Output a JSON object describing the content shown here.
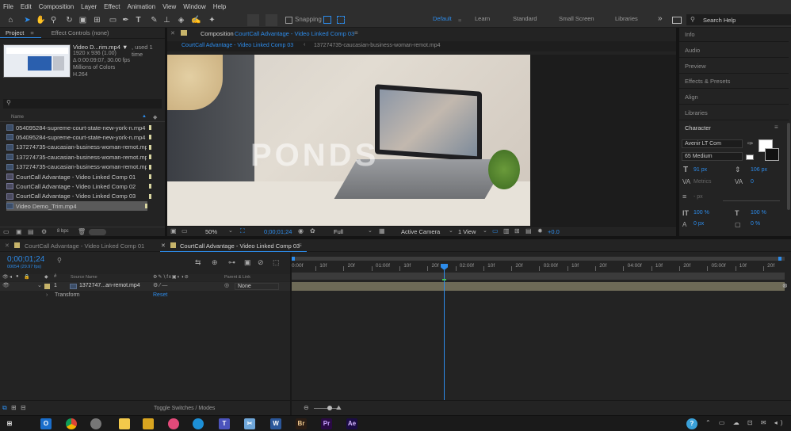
{
  "menu": [
    "File",
    "Edit",
    "Composition",
    "Layer",
    "Effect",
    "Animation",
    "View",
    "Window",
    "Help"
  ],
  "toolbar": {
    "snapping_label": "Snapping",
    "workspaces": [
      "Default",
      "Learn",
      "Standard",
      "Small Screen",
      "Libraries"
    ],
    "more": "»",
    "search_placeholder": "Search Help"
  },
  "project": {
    "tab_project": "Project",
    "tab_effects": "Effect Controls (none)",
    "thumb_name": "Video D...rim.mp4 ▼",
    "thumb_used": ", used 1 time",
    "thumb_res": "1920 x 936 (1.00)",
    "thumb_dur": "Δ 0:00:09:07, 30.00 fps",
    "thumb_colors": "Millions of Colors",
    "thumb_codec": "H.264",
    "search_placeholder": "",
    "col_name": "Name",
    "items": [
      {
        "name": "054095284-supreme-court-state-new-york-n.mp4",
        "type": "file"
      },
      {
        "name": "054095284-supreme-court-state-new-york-n.mp4",
        "type": "file"
      },
      {
        "name": "137274735-caucasian-business-woman-remot.mp4",
        "type": "file"
      },
      {
        "name": "137274735-caucasian-business-woman-remot.mp4",
        "type": "file"
      },
      {
        "name": "137274735-caucasian-business-woman-remot.mp4",
        "type": "file"
      },
      {
        "name": "CourtCall Advantage - Video Linked Comp 01",
        "type": "comp"
      },
      {
        "name": "CourtCall Advantage - Video Linked Comp 02",
        "type": "comp"
      },
      {
        "name": "CourtCall Advantage - Video Linked Comp 03",
        "type": "comp"
      },
      {
        "name": "Video Demo_Trim.mp4",
        "type": "file"
      }
    ],
    "bpc": "8 bpc"
  },
  "composition": {
    "title_prefix": "Composition",
    "title_comp": "CourtCall Advantage - Video Linked Comp 03",
    "tab_comp": "CourtCall Advantage - Video Linked Comp 03",
    "tab_layer": "137274735-caucasian-business-woman-remot.mp4",
    "watermark": "PONDS",
    "zoom": "50%",
    "timecode": "0;00;01;24",
    "resolution": "Full",
    "camera": "Active Camera",
    "view": "1 View",
    "exposure": "+0.0"
  },
  "right_panel": {
    "items": [
      "Info",
      "Audio",
      "Preview",
      "Effects & Presets",
      "Align",
      "Libraries"
    ],
    "character": "Character",
    "font": "Avenir LT Com",
    "style": "65 Medium",
    "size": "91 px",
    "leading": "106 px",
    "kerning": "Metrics",
    "tracking": "0",
    "stroke": "- px",
    "vscale": "100 %",
    "hscale": "100 %",
    "baseline": "0 px",
    "tsume": "0 %"
  },
  "timeline": {
    "tab_comp1": "CourtCall Advantage - Video Linked Comp 01",
    "tab_comp3": "CourtCall Advantage - Video Linked Comp 03",
    "timecode": "0;00;01;24",
    "fps": "00054 (29.97 fps)",
    "col_source": "Source Name",
    "col_parent": "Parent & Link",
    "layer_num": "1",
    "layer_name": "1372747...an-remot.mp4",
    "parent": "None",
    "transform": "Transform",
    "reset": "Reset",
    "ruler": [
      "0:00f",
      "10f",
      "20f",
      "01:00f",
      "10f",
      "20f",
      "02:00f",
      "10f",
      "20f",
      "03:00f",
      "10f",
      "20f",
      "04:00f",
      "10f",
      "20f",
      "05:00f",
      "10f",
      "20f"
    ],
    "toggle": "Toggle Switches / Modes"
  },
  "taskbar": {
    "apps": [
      "Outlook",
      "Chrome",
      "App",
      "Sticky",
      "Files",
      "Photos",
      "Edge",
      "Teams",
      "Snip",
      "Word",
      "Bridge",
      "Premiere",
      "After Effects"
    ]
  }
}
